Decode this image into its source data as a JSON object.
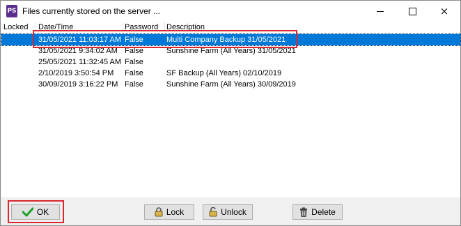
{
  "window": {
    "app_icon_text": "PS",
    "title": "Files currently stored on the server ...",
    "minimize": "minimize",
    "maximize": "maximize",
    "close": "×"
  },
  "table": {
    "columns": [
      "Locked",
      "Date/Time",
      "Password",
      "Description"
    ],
    "rows": [
      {
        "locked": "",
        "datetime": "31/05/2021 11:03:17 AM",
        "password": "False",
        "description": "Multi Company Backup 31/05/2021",
        "selected": true
      },
      {
        "locked": "",
        "datetime": "31/05/2021 9:34:02 AM",
        "password": "False",
        "description": "Sunshine Farm (All Years) 31/05/2021",
        "selected": false
      },
      {
        "locked": "",
        "datetime": "25/05/2021 11:32:45 AM",
        "password": "False",
        "description": "",
        "selected": false
      },
      {
        "locked": "",
        "datetime": "2/10/2019 3:50:54 PM",
        "password": "False",
        "description": "SF Backup (All Years) 02/10/2019",
        "selected": false
      },
      {
        "locked": "",
        "datetime": "30/09/2019 3:16:22 PM",
        "password": "False",
        "description": "Sunshine Farm (All Years) 30/09/2019",
        "selected": false
      }
    ]
  },
  "buttons": {
    "ok": "OK",
    "lock": "Lock",
    "unlock": "Unlock",
    "delete": "Delete"
  },
  "colors": {
    "selection": "#0078d7",
    "annotation_box": "#d9282f",
    "ok_check": "#1e9e2a"
  }
}
